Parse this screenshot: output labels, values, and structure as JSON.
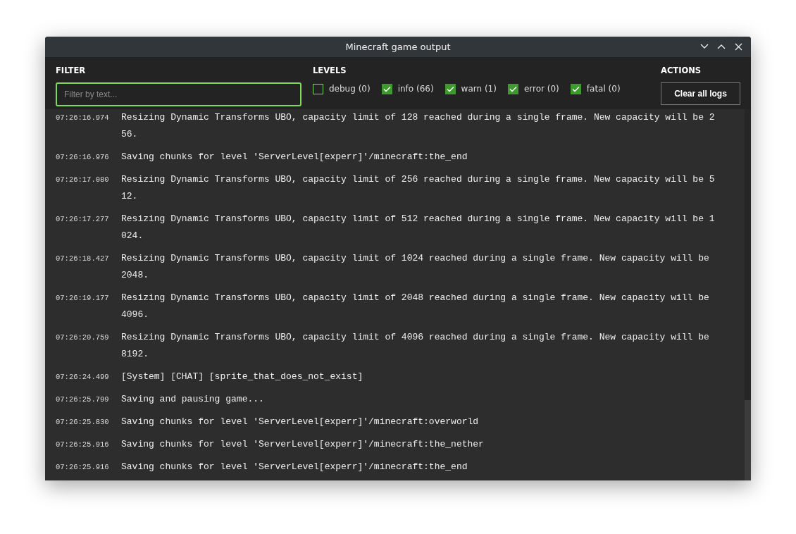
{
  "window": {
    "title": "Minecraft game output"
  },
  "filter": {
    "heading": "FILTER",
    "placeholder": "Filter by text..."
  },
  "levels": {
    "heading": "LEVELS",
    "items": [
      {
        "label": "debug (0)",
        "checked": false
      },
      {
        "label": "info (66)",
        "checked": true
      },
      {
        "label": "warn (1)",
        "checked": true
      },
      {
        "label": "error (0)",
        "checked": true
      },
      {
        "label": "fatal (0)",
        "checked": true
      }
    ]
  },
  "actions": {
    "heading": "ACTIONS",
    "buttons": [
      "Clear all logs"
    ]
  },
  "log": [
    {
      "time": "07:26:16.974",
      "message": "Resizing Dynamic Transforms UBO, capacity limit of 128 reached during a single frame. New capacity will be 256."
    },
    {
      "time": "07:26:16.976",
      "message": "Saving chunks for level 'ServerLevel[experr]'/minecraft:the_end"
    },
    {
      "time": "07:26:17.080",
      "message": "Resizing Dynamic Transforms UBO, capacity limit of 256 reached during a single frame. New capacity will be 512."
    },
    {
      "time": "07:26:17.277",
      "message": "Resizing Dynamic Transforms UBO, capacity limit of 512 reached during a single frame. New capacity will be 1024."
    },
    {
      "time": "07:26:18.427",
      "message": "Resizing Dynamic Transforms UBO, capacity limit of 1024 reached during a single frame. New capacity will be 2048."
    },
    {
      "time": "07:26:19.177",
      "message": "Resizing Dynamic Transforms UBO, capacity limit of 2048 reached during a single frame. New capacity will be 4096."
    },
    {
      "time": "07:26:20.759",
      "message": "Resizing Dynamic Transforms UBO, capacity limit of 4096 reached during a single frame. New capacity will be 8192."
    },
    {
      "time": "07:26:24.499",
      "message": "[System] [CHAT] [sprite_that_does_not_exist]"
    },
    {
      "time": "07:26:25.799",
      "message": "Saving and pausing game..."
    },
    {
      "time": "07:26:25.830",
      "message": "Saving chunks for level 'ServerLevel[experr]'/minecraft:overworld"
    },
    {
      "time": "07:26:25.916",
      "message": "Saving chunks for level 'ServerLevel[experr]'/minecraft:the_nether"
    },
    {
      "time": "07:26:25.916",
      "message": "Saving chunks for level 'ServerLevel[experr]'/minecraft:the_end"
    }
  ]
}
